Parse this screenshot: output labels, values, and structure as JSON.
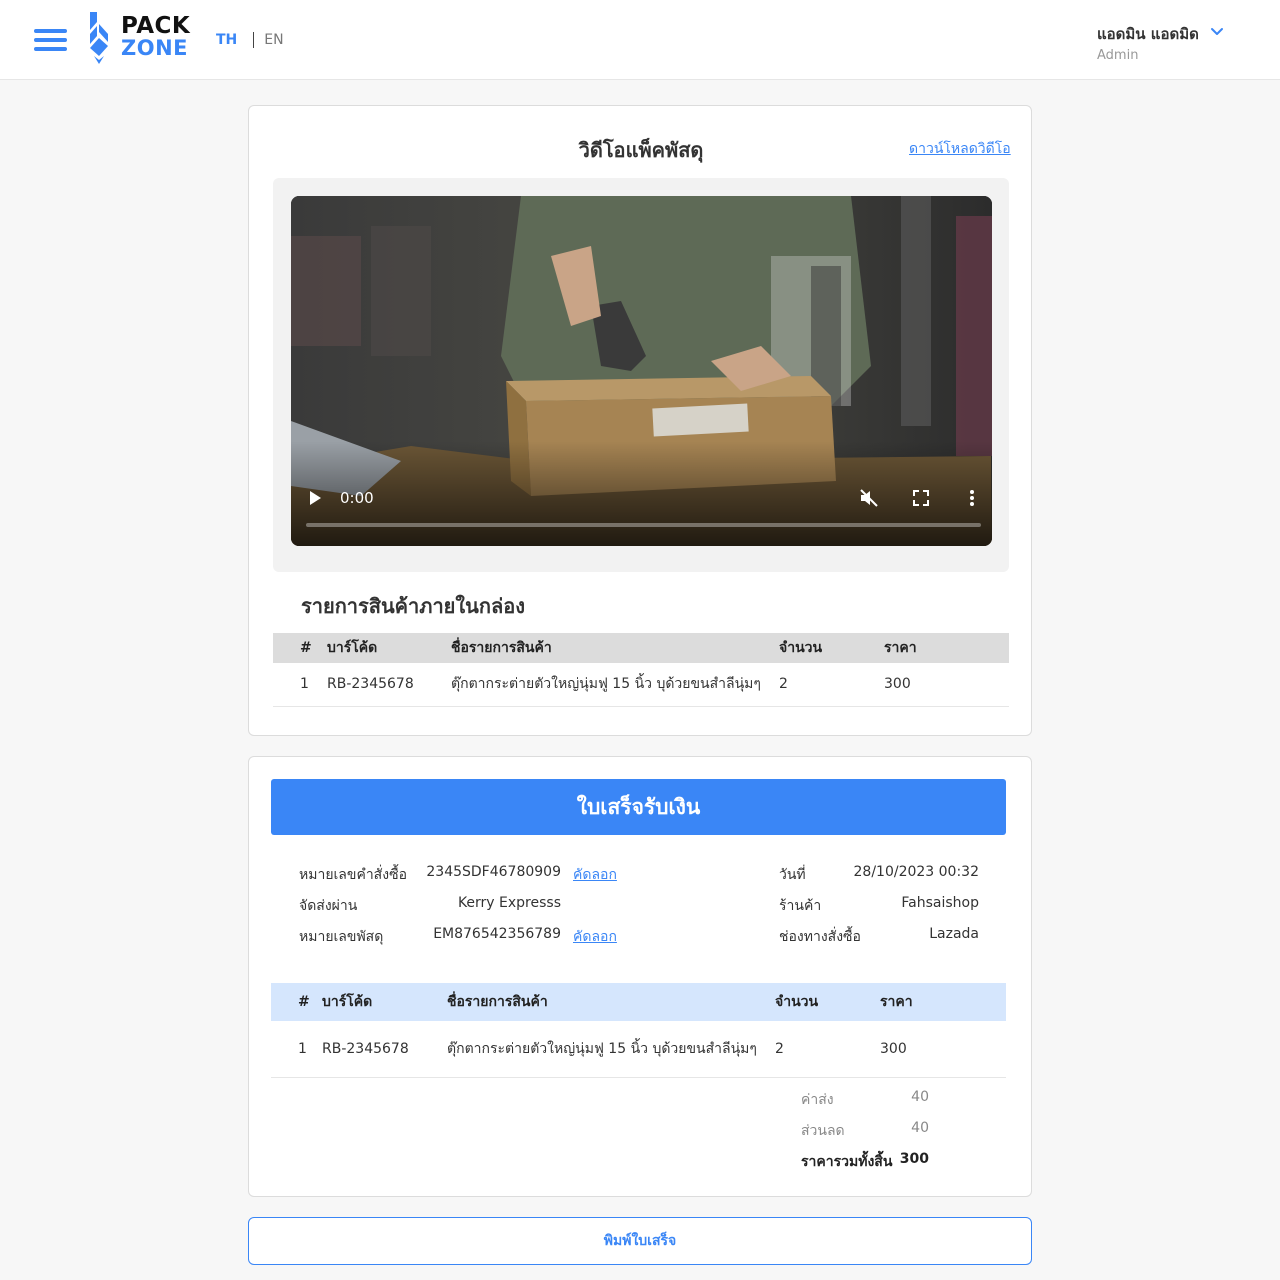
{
  "header": {
    "logo_line1": "PACK",
    "logo_line2": "ZONE",
    "lang_th": "TH",
    "lang_en": "EN",
    "user_name": "แอดมิน แอดมิด",
    "user_role": "Admin"
  },
  "video": {
    "title": "วิดีโอแพ็คพัสดุ",
    "download_label": "ดาวน์โหลดวิดีโอ",
    "current_time": "0:00",
    "progress": 0
  },
  "box_items": {
    "title": "รายการสินค้าภายในกล่อง",
    "columns": [
      "#",
      "บาร์โค้ด",
      "ชื่อรายการสินค้า",
      "จำนวน",
      "ราคา"
    ],
    "rows": [
      [
        "1",
        "RB-2345678",
        "ตุ๊กตากระต่ายตัวใหญ่นุ่มฟู 15 นิ้ว บุด้วยขนสำลีนุ่มๆ",
        "2",
        "300"
      ]
    ]
  },
  "receipt": {
    "title": "ใบเสร็จรับเงิน",
    "order_no_label": "หมายเลขคำสั่งซื้อ",
    "order_no": "2345SDF46780909",
    "copy_label": "คัดลอก",
    "shipped_via_label": "จัดส่งผ่าน",
    "shipped_via": "Kerry Expresss",
    "tracking_label": "หมายเลขพัสดุ",
    "tracking_no": "EM876542356789",
    "date_label": "วันที่",
    "date": "28/10/2023 00:32",
    "shop_label": "ร้านค้า",
    "shop": "Fahsaishop",
    "channel_label": "ช่องทางสั่งซื้อ",
    "channel": "Lazada",
    "columns": [
      "#",
      "บาร์โค้ด",
      "ชื่อรายการสินค้า",
      "จำนวน",
      "ราคา"
    ],
    "rows": [
      [
        "1",
        "RB-2345678",
        "ตุ๊กตากระต่ายตัวใหญ่นุ่มฟู 15 นิ้ว บุด้วยขนสำลีนุ่มๆ",
        "2",
        "300"
      ]
    ],
    "shipping_label": "ค่าส่ง",
    "shipping": "40",
    "discount_label": "ส่วนลด",
    "discount": "40",
    "total_label": "ราคารวมทั้งสิ้น",
    "total": "300"
  },
  "print_label": "พิมพ์ใบเสร็จ",
  "colors": {
    "accent": "#3a86f6",
    "table_head_gray": "#dcdcdc",
    "table_head_blue": "#d5e6fd"
  }
}
